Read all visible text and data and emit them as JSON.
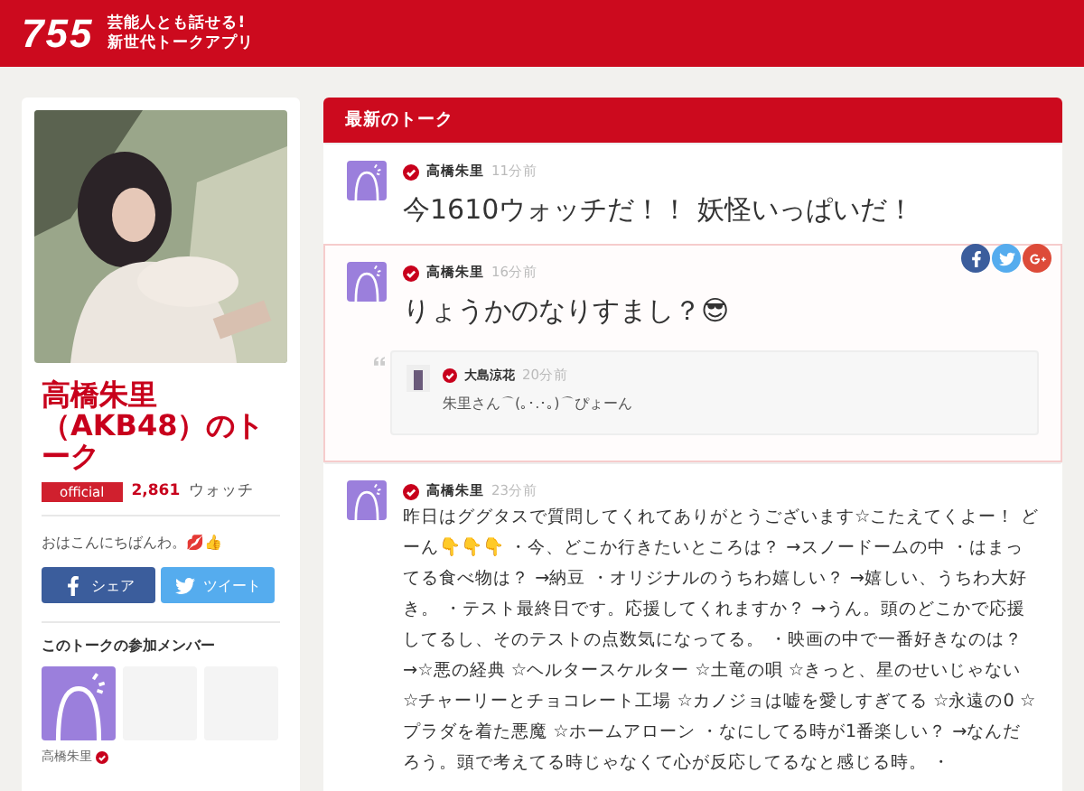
{
  "header": {
    "logo": "755",
    "tagline": [
      "芸能人とも話せる!",
      "新世代トークアプリ"
    ]
  },
  "profile": {
    "title": "高橋朱里（AKB48）のトーク",
    "badge": "official",
    "watch_count": "2,861",
    "watch_label": "ウォッチ",
    "bio": "おはこんにちばんわ。💋👍",
    "share_buttons": [
      {
        "kind": "facebook",
        "label": "シェア"
      },
      {
        "kind": "twitter",
        "label": "ツイート"
      }
    ],
    "members_heading": "このトークの参加メンバー",
    "members": [
      {
        "kind": "member",
        "name": "高橋朱里",
        "verified": true
      },
      {
        "kind": "empty"
      },
      {
        "kind": "empty"
      }
    ]
  },
  "talk": {
    "heading": "最新のトーク",
    "posts": [
      {
        "author": "高橋朱里",
        "verified": true,
        "time": "11分前",
        "kind": "short",
        "highlighted": false,
        "text": "今1610ウォッチだ！！ 妖怪いっぱいだ！"
      },
      {
        "author": "高橋朱里",
        "verified": true,
        "time": "16分前",
        "kind": "short",
        "highlighted": true,
        "share": [
          {
            "kind": "facebook"
          },
          {
            "kind": "twitter"
          },
          {
            "kind": "google-plus"
          }
        ],
        "text": "りょうかのなりすまし？😎",
        "quote": {
          "author": "大島涼花",
          "verified": true,
          "time": "20分前",
          "text": "朱里さん⌒(｡･.･｡)⌒ぴょーん"
        }
      },
      {
        "author": "高橋朱里",
        "verified": true,
        "time": "23分前",
        "kind": "long",
        "highlighted": false,
        "text": "昨日はググタスで質問してくれてありがとうございます☆こたえてくよー！ どーん👇👇👇 ・今、どこか行きたいところは？ →スノードームの中 ・はまってる食べ物は？ →納豆 ・オリジナルのうちわ嬉しい？ →嬉しい、うちわ大好き。 ・テスト最終日です。応援してくれますか？ →うん。頭のどこかで応援してるし、そのテストの点数気になってる。 ・映画の中で一番好きなのは？ →☆悪の経典 ☆ヘルタースケルター ☆土竜の唄 ☆きっと、星のせいじゃない ☆チャーリーとチョコレート工場 ☆カノジョは嘘を愛しすぎてる ☆永遠の0 ☆プラダを着た悪魔 ☆ホームアローン ・なにしてる時が1番楽しい？ →なんだろう。頭で考えてる時じゃなくて心が反応してるなと感じる時。 ・"
      }
    ]
  }
}
